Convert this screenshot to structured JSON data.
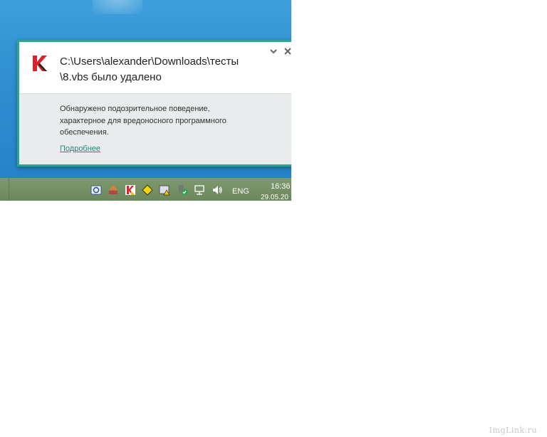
{
  "notification": {
    "title_line1": "C:\\Users\\alexander\\Downloads\\тесты",
    "title_line2": "\\8.vbs было удалено",
    "message_line1": "Обнаружено подозрительное поведение,",
    "message_line2": "характерное для вредоносного программного",
    "message_line3": "обеспечения.",
    "link_label": "Подробнее",
    "accent_color": "#2aa58e",
    "icons": {
      "logo": "kaspersky-k-icon",
      "collapse": "chevron-down-icon",
      "close": "close-icon"
    }
  },
  "taskbar": {
    "language": "ENG",
    "time": "16:36",
    "date": "29.05.20",
    "tray_icons": [
      "app-icon",
      "network-share-icon",
      "kaspersky-tray-icon",
      "security-alert-icon",
      "warning-app-icon",
      "usb-safe-icon",
      "network-icon",
      "volume-icon"
    ]
  },
  "watermark": "ImgLink.ru"
}
